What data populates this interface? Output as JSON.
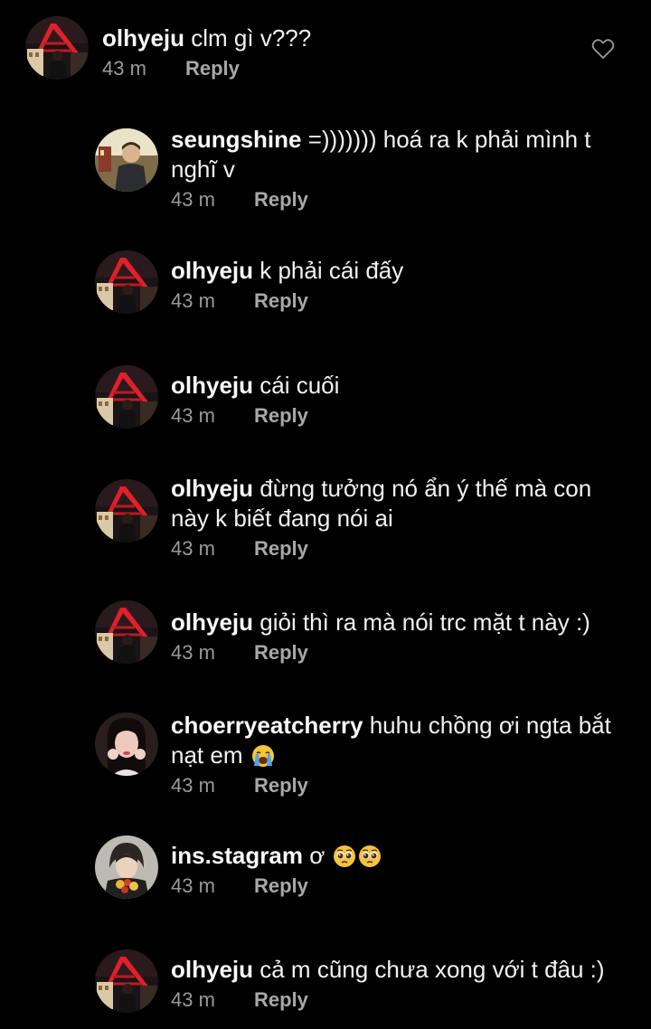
{
  "comments": [
    {
      "username": "olhyeju",
      "text": "clm gì v???",
      "time": "43 m",
      "reply": "Reply",
      "avatar": "night-city-avatar-icon"
    },
    {
      "username": "seungshine",
      "text": "=))))))) hoá ra k phải mình t nghĩ v",
      "time": "43 m",
      "reply": "Reply",
      "avatar": "boy-outdoor-avatar-icon"
    },
    {
      "username": "olhyeju",
      "text": "k phải cái đấy",
      "time": "43 m",
      "reply": "Reply",
      "avatar": "night-city-avatar-icon"
    },
    {
      "username": "olhyeju",
      "text": "cái cuối",
      "time": "43 m",
      "reply": "Reply",
      "avatar": "night-city-avatar-icon"
    },
    {
      "username": "olhyeju",
      "text": "đừng tưởng nó ẩn ý thế mà con này k biết đang nói ai",
      "time": "43 m",
      "reply": "Reply",
      "avatar": "night-city-avatar-icon"
    },
    {
      "username": "olhyeju",
      "text": "giỏi thì ra mà nói trc mặt t này :)",
      "time": "43 m",
      "reply": "Reply",
      "avatar": "night-city-avatar-icon"
    },
    {
      "username": "choerryeatcherry",
      "text": "huhu chồng ơi ngta bắt nạt em",
      "emoji": "crying-face-emoji",
      "time": "43 m",
      "reply": "Reply",
      "avatar": "girl-portrait-avatar-icon"
    },
    {
      "username": "ins.stagram",
      "text": "ơ",
      "emoji": "pleading-face-emoji",
      "time": "43 m",
      "reply": "Reply",
      "avatar": "person-flowers-avatar-icon"
    },
    {
      "username": "olhyeju",
      "text": "cả m cũng chưa xong với t đâu :)",
      "time": "43 m",
      "reply": "Reply",
      "avatar": "night-city-avatar-icon"
    }
  ],
  "icons": {
    "like": "heart-outline-icon"
  },
  "colors": {
    "background": "#000000",
    "text": "#f2f2f2",
    "meta": "#9a9a9a"
  }
}
